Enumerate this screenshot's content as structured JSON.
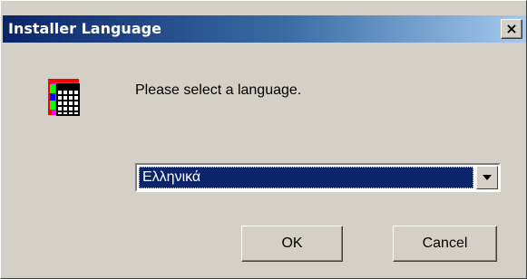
{
  "window": {
    "title": "Installer Language",
    "close_label": "×"
  },
  "dialog": {
    "prompt": "Please select a language.",
    "icon": "installer-grid-icon"
  },
  "language_select": {
    "selected_value": "Ελληνικά",
    "arrow_icon": "chevron-down-icon"
  },
  "buttons": {
    "ok_label": "OK",
    "cancel_label": "Cancel"
  },
  "colors": {
    "titlebar_start": "#0a246a",
    "titlebar_end": "#a6caf0",
    "face": "#d4d0c8",
    "selection": "#0a246a"
  }
}
